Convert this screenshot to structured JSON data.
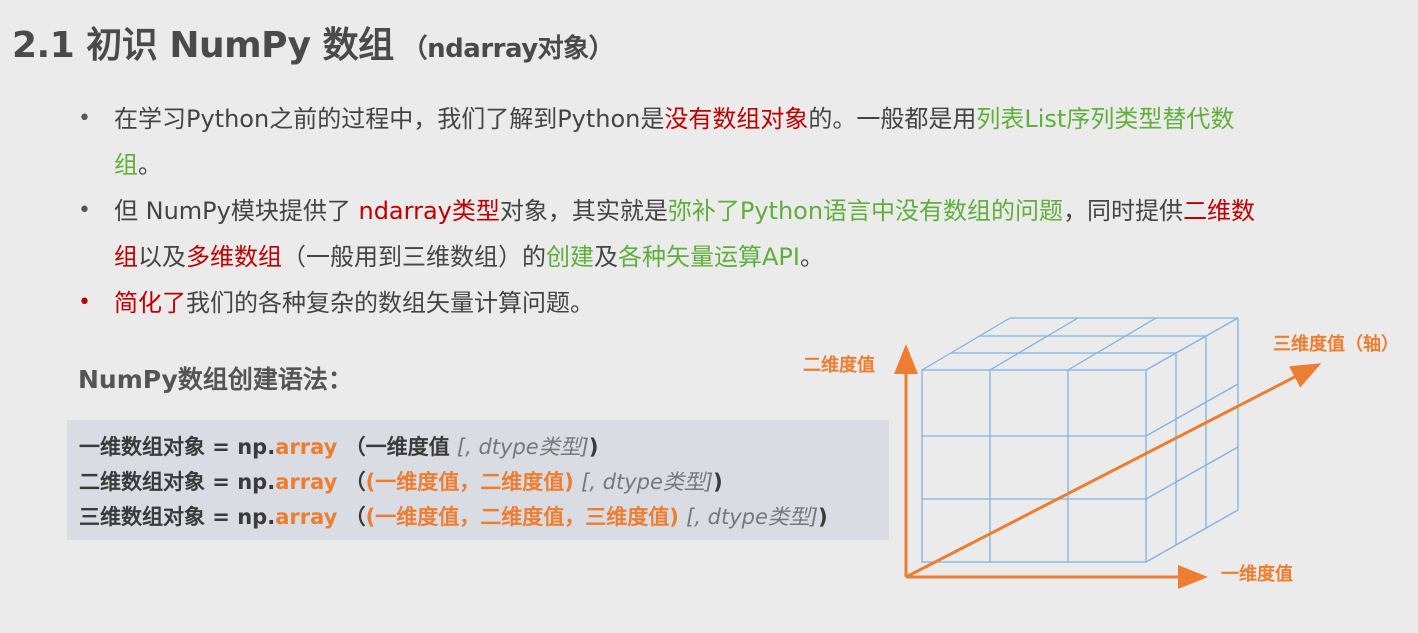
{
  "slide": {
    "title": "2.1 初识 NumPy 数组",
    "title_sub": "（ndarray对象）"
  },
  "bullets": [
    {
      "parts": [
        {
          "text": "在学习Python之前的过程中，我们了解到Python是",
          "color": "normal"
        },
        {
          "text": "没有数组对象",
          "color": "red"
        },
        {
          "text": "的。一般都是用",
          "color": "normal"
        },
        {
          "text": "列表List序列类型替代数组",
          "color": "green"
        },
        {
          "text": "。",
          "color": "normal"
        }
      ]
    },
    {
      "parts": [
        {
          "text": "但 NumPy模块提供了 ",
          "color": "normal"
        },
        {
          "text": "ndarray类型",
          "color": "red"
        },
        {
          "text": "对象，其实就是",
          "color": "normal"
        },
        {
          "text": "弥补了Python语言中没有数组的问题",
          "color": "green"
        },
        {
          "text": "，同时提供",
          "color": "normal"
        },
        {
          "text": "二维数组",
          "color": "red"
        },
        {
          "text": "以及",
          "color": "normal"
        },
        {
          "text": "多维数组",
          "color": "red"
        },
        {
          "text": "（一般用到三维数组）的",
          "color": "normal"
        },
        {
          "text": "创建",
          "color": "green"
        },
        {
          "text": "及",
          "color": "normal"
        },
        {
          "text": "各种矢量运算API",
          "color": "green"
        },
        {
          "text": "。",
          "color": "normal"
        }
      ]
    },
    {
      "parts": [
        {
          "text": "简化了",
          "color": "red"
        },
        {
          "text": "我们的各种复杂的数组矢量计算问题。",
          "color": "normal"
        }
      ]
    }
  ],
  "syntax": {
    "title": "NumPy数组创建语法：",
    "lines": [
      {
        "prefix": "一维数组对象 = np.",
        "func": "array",
        "open": "（一维度值",
        "inner": "",
        "hint": "[, dtype类型]",
        "close": ")"
      },
      {
        "prefix": "二维数组对象 = np.",
        "func": "array",
        "open": "（",
        "inner": "(一维度值，二维度值)",
        "hint": "[, dtype类型]",
        "close": ")"
      },
      {
        "prefix": "三维数组对象 = np.",
        "func": "array",
        "open": "（",
        "inner": "(一维度值，二维度值，三维度值)",
        "hint": "[, dtype类型]",
        "close": ")"
      }
    ]
  },
  "diagram": {
    "label_dim2": "二维度值",
    "label_dim3": "三维度值（轴）",
    "label_dim1": "一维度值",
    "axis_color": "#ed7d31",
    "grid_color": "#7fb2e5"
  },
  "colors": {
    "red": "#c00000",
    "green": "#5faf3a",
    "orange": "#ed7d31"
  }
}
